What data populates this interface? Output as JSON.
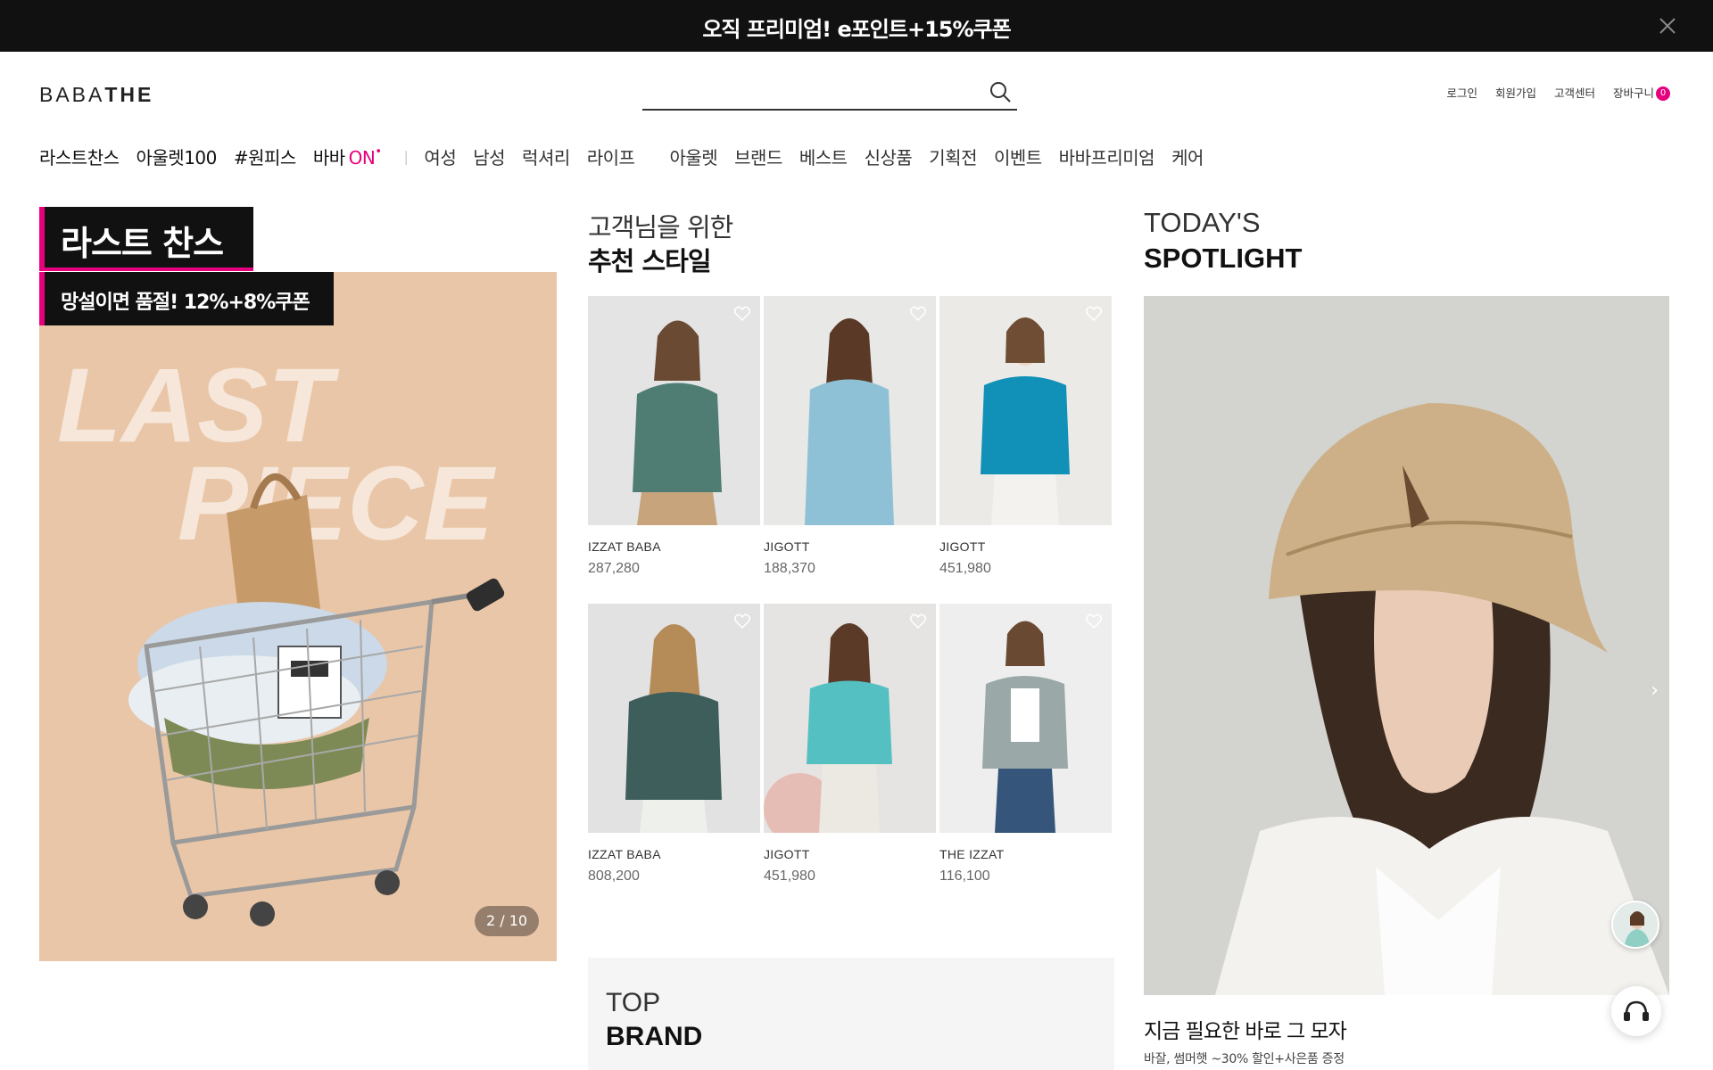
{
  "promo": {
    "text": "오직 프리미엄! e포인트+15%쿠폰",
    "close_icon": "close-icon"
  },
  "header": {
    "logo_a": "BABA",
    "logo_b": "THE",
    "search_placeholder": "",
    "util": {
      "login": "로그인",
      "join": "회원가입",
      "cs": "고객센터",
      "cart": "장바구니",
      "cart_count": "0"
    }
  },
  "nav": {
    "primary": [
      "라스트찬스",
      "아울렛100",
      "#원피스",
      "바바"
    ],
    "on_label": "ON",
    "secondary": [
      "여성",
      "남성",
      "럭셔리",
      "라이프"
    ],
    "tertiary": [
      "아울렛",
      "브랜드",
      "베스트",
      "신상품",
      "기획전",
      "이벤트",
      "바바프리미엄",
      "케어"
    ]
  },
  "last_chance": {
    "tag": "라스트 찬스",
    "subtitle": "망설이면 품절! 12%+8%쿠폰",
    "image_text": [
      "LAST",
      "PIECE"
    ],
    "counter_current": "2",
    "counter_sep": " / ",
    "counter_total": "10"
  },
  "recommend": {
    "heading_light": "고객님을 위한",
    "heading_bold": "추천 스타일",
    "products": [
      {
        "brand": "IZZAT BABA",
        "price": "287,280",
        "color": "#4f7d73",
        "bg": "#e4e4e4"
      },
      {
        "brand": "JIGOTT",
        "price": "188,370",
        "color": "#8fc1d6",
        "bg": "#e8e8e6"
      },
      {
        "brand": "JIGOTT",
        "price": "451,980",
        "color": "#1291b8",
        "bg": "#eceae6"
      },
      {
        "brand": "IZZAT BABA",
        "price": "808,200",
        "color": "#3e5e5c",
        "bg": "#e2e2e2"
      },
      {
        "brand": "JIGOTT",
        "price": "451,980",
        "color": "#55c0c2",
        "bg": "#e6e4e2"
      },
      {
        "brand": "THE IZZAT",
        "price": "116,100",
        "color": "#9aa8a8",
        "bg": "#eeeeee"
      }
    ]
  },
  "top_brand": {
    "light": "TOP",
    "bold": "BRAND"
  },
  "spotlight": {
    "heading_light": "TODAY'S",
    "heading_bold": "SPOTLIGHT",
    "title": "지금 필요한 바로 그 모자",
    "desc": "바잘, 썸머햇 ~30% 할인+사은품 증정"
  },
  "colors": {
    "accent": "#e6007e",
    "promo_bg": "#111111"
  }
}
